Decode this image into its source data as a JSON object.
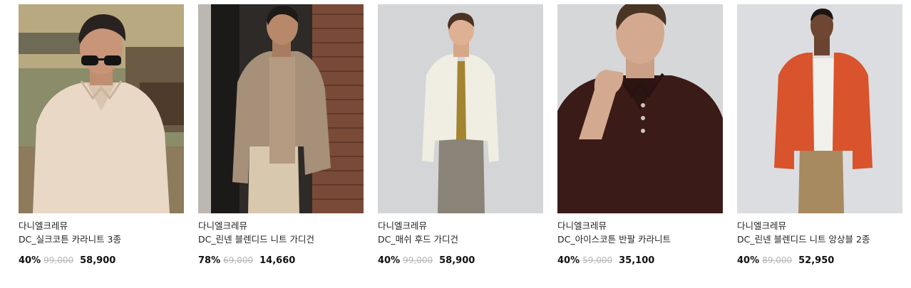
{
  "products": [
    {
      "brand": "다니엘크레뮤",
      "name": "DC_실크코튼 카라니트 3종",
      "discount": "40%",
      "original_price": "99,000",
      "sale_price": "58,900"
    },
    {
      "brand": "다니엘크레뮤",
      "name": "DC_린넨 블렌디드 니트 가디건",
      "discount": "78%",
      "original_price": "69,000",
      "sale_price": "14,660"
    },
    {
      "brand": "다니엘크레뮤",
      "name": "DC_매쉬 후드 가디건",
      "discount": "40%",
      "original_price": "99,000",
      "sale_price": "58,900"
    },
    {
      "brand": "다니엘크레뮤",
      "name": "DC_아이스코튼 반팔 카라니트",
      "discount": "40%",
      "original_price": "59,000",
      "sale_price": "35,100"
    },
    {
      "brand": "다니엘크레뮤",
      "name": "DC_린넨 블렌디드 니트 앙상블 2종",
      "discount": "40%",
      "original_price": "89,000",
      "sale_price": "52,950"
    }
  ],
  "colors": {
    "discount": "#111111",
    "original_price": "#b5b5b5",
    "sale_price": "#111111"
  }
}
